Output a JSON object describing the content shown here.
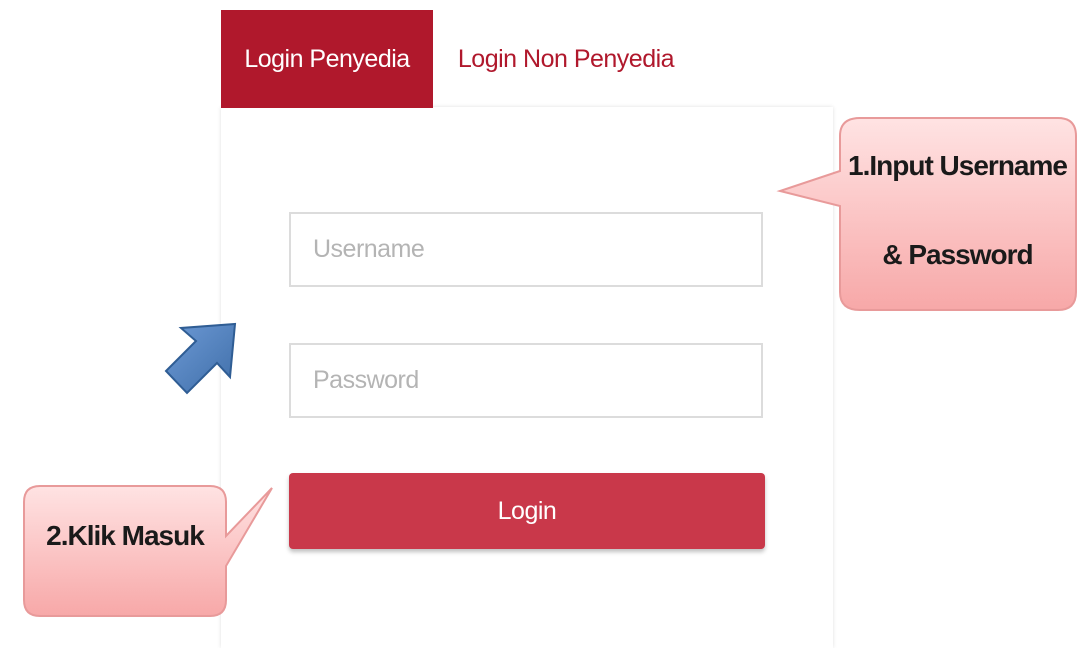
{
  "tabs": {
    "active": "Login Penyedia",
    "inactive": "Login Non Penyedia"
  },
  "form": {
    "username_placeholder": "Username",
    "password_placeholder": "Password",
    "login_label": "Login"
  },
  "annotations": {
    "callout1_line1": "1.Input Username",
    "callout1_line2": "& Password",
    "callout2": "2.Klik Masuk"
  },
  "colors": {
    "brand_dark": "#b0182c",
    "button": "#c9384a",
    "callout_fill": "#ffc9c9",
    "callout_border": "#e89a9a",
    "arrow_fill": "#4f81bd"
  }
}
